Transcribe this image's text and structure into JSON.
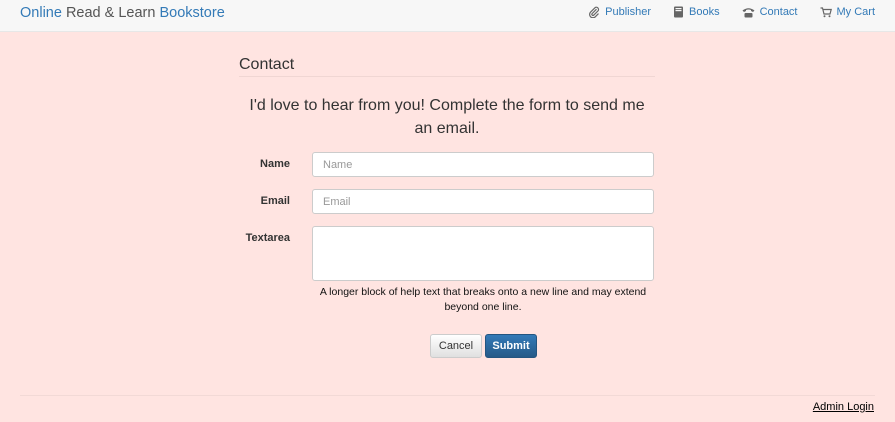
{
  "navbar": {
    "brand": {
      "part1": "Online",
      "part2": " Read & Learn ",
      "part3": "Bookstore"
    },
    "links": [
      {
        "label": "Publisher",
        "icon": "paperclip-icon"
      },
      {
        "label": "Books",
        "icon": "book-icon"
      },
      {
        "label": "Contact",
        "icon": "phone-icon"
      },
      {
        "label": "My Cart",
        "icon": "cart-icon"
      }
    ]
  },
  "contact": {
    "title": "Contact",
    "lead": "I'd love to hear from you! Complete the form to send me an email.",
    "fields": {
      "name": {
        "label": "Name",
        "placeholder": "Name",
        "value": ""
      },
      "email": {
        "label": "Email",
        "placeholder": "Email",
        "value": ""
      },
      "textarea": {
        "label": "Textarea",
        "value": ""
      }
    },
    "help_text": "A longer block of help text that breaks onto a new line and may extend beyond one line.",
    "cancel_label": "Cancel",
    "submit_label": "Submit"
  },
  "footer": {
    "admin_login": "Admin Login"
  },
  "colors": {
    "page_background": "#ffe4e1",
    "link_blue": "#337ab7",
    "primary_button": "#286090"
  }
}
